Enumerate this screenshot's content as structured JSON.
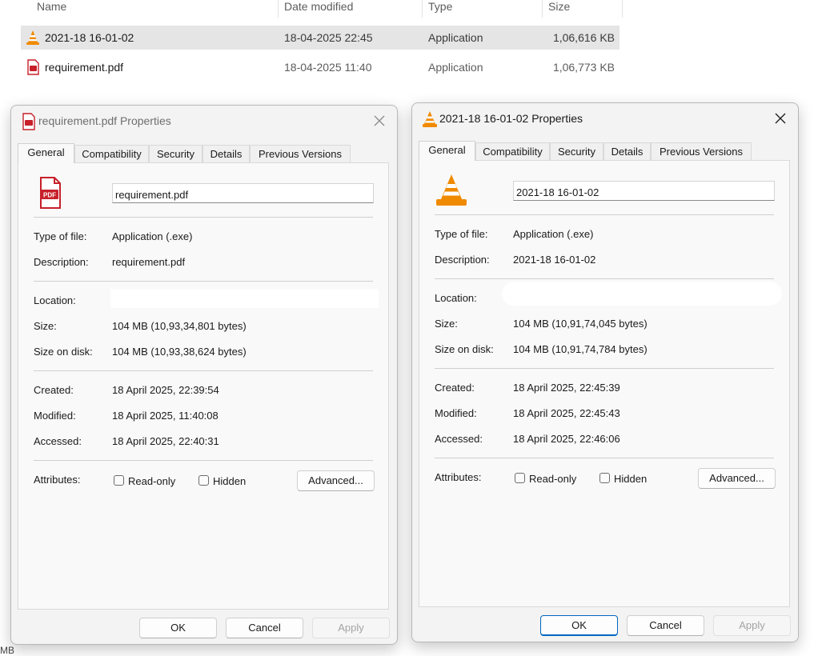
{
  "explorer": {
    "columns": {
      "name": "Name",
      "date": "Date modified",
      "type": "Type",
      "size": "Size"
    },
    "files": [
      {
        "name": "2021-18 16-01-02",
        "date": "18-04-2025 22:45",
        "type": "Application",
        "size": "1,06,616 KB",
        "icon": "vlc-cone-icon",
        "selected": true
      },
      {
        "name": "requirement.pdf",
        "date": "18-04-2025 11:40",
        "type": "Application",
        "size": "1,06,773 KB",
        "icon": "pdf-file-icon",
        "selected": false
      }
    ],
    "footer_fragment": "MB"
  },
  "tabs": [
    "General",
    "Compatibility",
    "Security",
    "Details",
    "Previous Versions"
  ],
  "labels": {
    "type_of_file": "Type of file:",
    "description": "Description:",
    "location": "Location:",
    "size": "Size:",
    "size_on_disk": "Size on disk:",
    "created": "Created:",
    "modified": "Modified:",
    "accessed": "Accessed:",
    "attributes": "Attributes:",
    "read_only": "Read-only",
    "hidden": "Hidden",
    "advanced": "Advanced...",
    "ok": "OK",
    "cancel": "Cancel",
    "apply": "Apply"
  },
  "dialog_left": {
    "title": "requirement.pdf Properties",
    "file_name": "requirement.pdf",
    "type_of_file": "Application (.exe)",
    "description": "requirement.pdf",
    "location": "",
    "size": "104 MB (10,93,34,801 bytes)",
    "size_on_disk": "104 MB (10,93,38,624 bytes)",
    "created": "18 April 2025, 22:39:54",
    "modified": "18 April 2025, 11:40:08",
    "accessed": "18 April 2025, 22:40:31",
    "read_only": false,
    "hidden": false,
    "icon": "pdf-file-icon",
    "icon_text": "PDF",
    "active": false
  },
  "dialog_right": {
    "title": "2021-18 16-01-02 Properties",
    "file_name": "2021-18 16-01-02",
    "type_of_file": "Application (.exe)",
    "description": "2021-18 16-01-02",
    "location": "",
    "size": "104 MB (10,91,74,045 bytes)",
    "size_on_disk": "104 MB (10,91,74,784 bytes)",
    "created": "18 April 2025, 22:45:39",
    "modified": "18 April 2025, 22:45:43",
    "accessed": "18 April 2025, 22:46:06",
    "read_only": false,
    "hidden": false,
    "icon": "vlc-cone-icon",
    "active": true
  },
  "colors": {
    "accent": "#0067c0",
    "pdf_red": "#c7202a",
    "vlc_orange": "#f08a00",
    "selection": "#e5e5e5"
  }
}
